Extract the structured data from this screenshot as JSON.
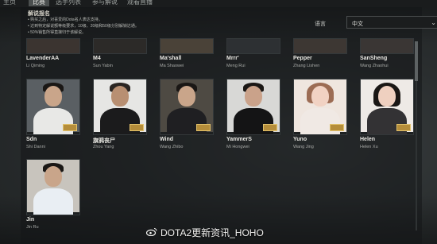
{
  "nav": {
    "items": [
      {
        "label": "主页",
        "active": false
      },
      {
        "label": "比赛",
        "active": true
      },
      {
        "label": "选手列表",
        "active": false
      },
      {
        "label": "参与解说",
        "active": false
      },
      {
        "label": "观看直播",
        "active": false
      }
    ]
  },
  "info": {
    "title": "解说报名",
    "bullets": [
      "购买之后，对喜爱的Dota名人表达支持。",
      "达到特定解说额等级要求，10级、20级和50级分别解锁达通。",
      "50%销售所得直接归于该解说。"
    ]
  },
  "language": {
    "label": "语言",
    "selected": "中文"
  },
  "casters": [
    {
      "handle": "LavenderAA",
      "name": "Li Qiming"
    },
    {
      "handle": "M4",
      "name": "Sun Yabin"
    },
    {
      "handle": "Ma'shall",
      "name": "Ma Shaowei"
    },
    {
      "handle": "Mrrr'",
      "name": "Meng Rui"
    },
    {
      "handle": "Pepper",
      "name": "Zhang Lishen"
    },
    {
      "handle": "SanSheng",
      "name": "Wang Zhaohui"
    },
    {
      "handle": "Sdn",
      "name": "Shi Danni"
    },
    {
      "handle": "旗鸦丧尸",
      "name": "Zhou Yang"
    },
    {
      "handle": "Wind",
      "name": "Wang Zhibo"
    },
    {
      "handle": "YammerS",
      "name": "Mi Hongwei"
    },
    {
      "handle": "Yuno",
      "name": "Wang Jing"
    },
    {
      "handle": "Helen",
      "name": "Helen Xu"
    },
    {
      "handle": "Jin",
      "name": "Jin Ru"
    }
  ],
  "watermark": "DOTA2更新资讯_HOHO",
  "colors": {
    "accent_gold": "#b58d3a",
    "panel_bg": "#141617",
    "text": "#e9e8e3"
  }
}
